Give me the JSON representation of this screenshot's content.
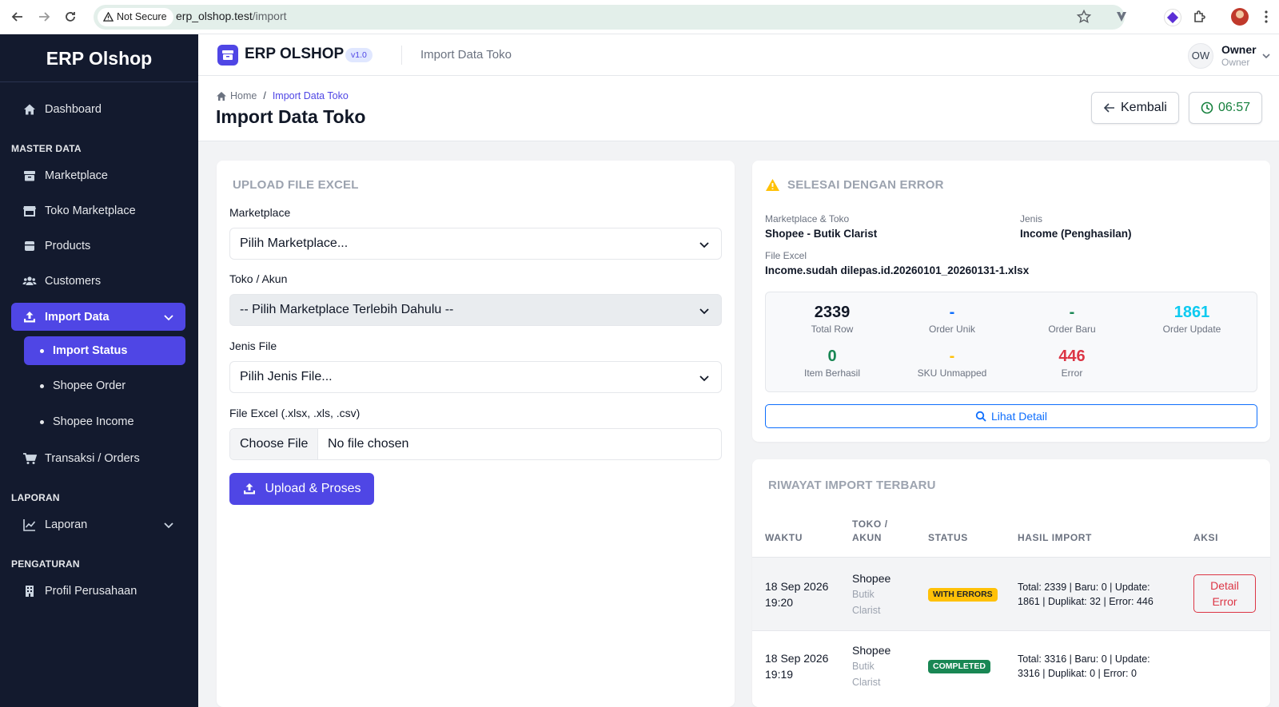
{
  "browser": {
    "security_label": "Not Secure",
    "url_host": "erp_olshop.test",
    "url_path": "/import"
  },
  "sidebar": {
    "brand": "ERP Olshop",
    "dashboard": "Dashboard",
    "section_master": "MASTER DATA",
    "marketplace": "Marketplace",
    "toko": "Toko Marketplace",
    "products": "Products",
    "customers": "Customers",
    "import_data": "Import Data",
    "import_status": "Import Status",
    "shopee_order": "Shopee Order",
    "shopee_income": "Shopee Income",
    "transaksi": "Transaksi / Orders",
    "section_laporan": "LAPORAN",
    "laporan": "Laporan",
    "section_pengaturan": "PENGATURAN",
    "profil": "Profil Perusahaan"
  },
  "topbar": {
    "app_name": "ERP OLSHOP",
    "version": "v1.0",
    "page": "Import Data Toko",
    "user_initials": "OW",
    "user_name": "Owner",
    "user_role": "Owner"
  },
  "header": {
    "crumb_home": "Home",
    "crumb_current": "Import Data Toko",
    "title": "Import Data Toko",
    "back_label": "Kembali",
    "timer": "06:57"
  },
  "upload": {
    "title": "UPLOAD FILE EXCEL",
    "marketplace_label": "Marketplace",
    "marketplace_value": "Pilih Marketplace...",
    "toko_label": "Toko / Akun",
    "toko_value": "-- Pilih Marketplace Terlebih Dahulu --",
    "jenis_label": "Jenis File",
    "jenis_value": "Pilih Jenis File...",
    "file_label": "File Excel (.xlsx, .xls, .csv)",
    "choose_file": "Choose File",
    "no_file": "No file chosen",
    "submit": "Upload & Proses"
  },
  "result": {
    "title": "SELESAI DENGAN ERROR",
    "mp_label": "Marketplace & Toko",
    "mp_value": "Shopee - Butik Clarist",
    "jenis_label": "Jenis",
    "jenis_value": "Income (Penghasilan)",
    "file_label": "File Excel",
    "file_value": "Income.sudah dilepas.id.20260101_20260131-1.xlsx",
    "stats": {
      "total_row": "2339",
      "total_row_label": "Total Row",
      "order_unik": "-",
      "order_unik_label": "Order Unik",
      "order_baru": "-",
      "order_baru_label": "Order Baru",
      "order_update": "1861",
      "order_update_label": "Order Update",
      "item_berhasil": "0",
      "item_berhasil_label": "Item Berhasil",
      "sku_unmapped": "-",
      "sku_unmapped_label": "SKU Unmapped",
      "error": "446",
      "error_label": "Error"
    },
    "detail_button": "Lihat Detail"
  },
  "history": {
    "title": "RIWAYAT IMPORT TERBARU",
    "col_waktu": "WAKTU",
    "col_toko_1": "TOKO /",
    "col_toko_2": "AKUN",
    "col_status": "STATUS",
    "col_hasil": "HASIL IMPORT",
    "col_aksi": "AKSI",
    "rows": [
      {
        "date": "18 Sep 2026",
        "time": "19:20",
        "marketplace": "Shopee",
        "toko_1": "Butik",
        "toko_2": "Clarist",
        "status": "WITH ERRORS",
        "hasil_1": "Total: 2339 | Baru: 0 | Update:",
        "hasil_2": "1861 | Duplikat: 32 | Error: 446",
        "aksi_1": "Detail",
        "aksi_2": "Error"
      },
      {
        "date": "18 Sep 2026",
        "time": "19:19",
        "marketplace": "Shopee",
        "toko_1": "Butik",
        "toko_2": "Clarist",
        "status": "COMPLETED",
        "hasil_1": "Total: 3316 | Baru: 0 | Update:",
        "hasil_2": "3316 | Duplikat: 0 | Error: 0"
      }
    ]
  },
  "colors": {
    "accent": "#4f46e5",
    "sidebar_bg": "#131a2e",
    "success": "#15803d",
    "info": "#0dcaf0",
    "warning": "#ffc107",
    "danger": "#dc3545"
  }
}
